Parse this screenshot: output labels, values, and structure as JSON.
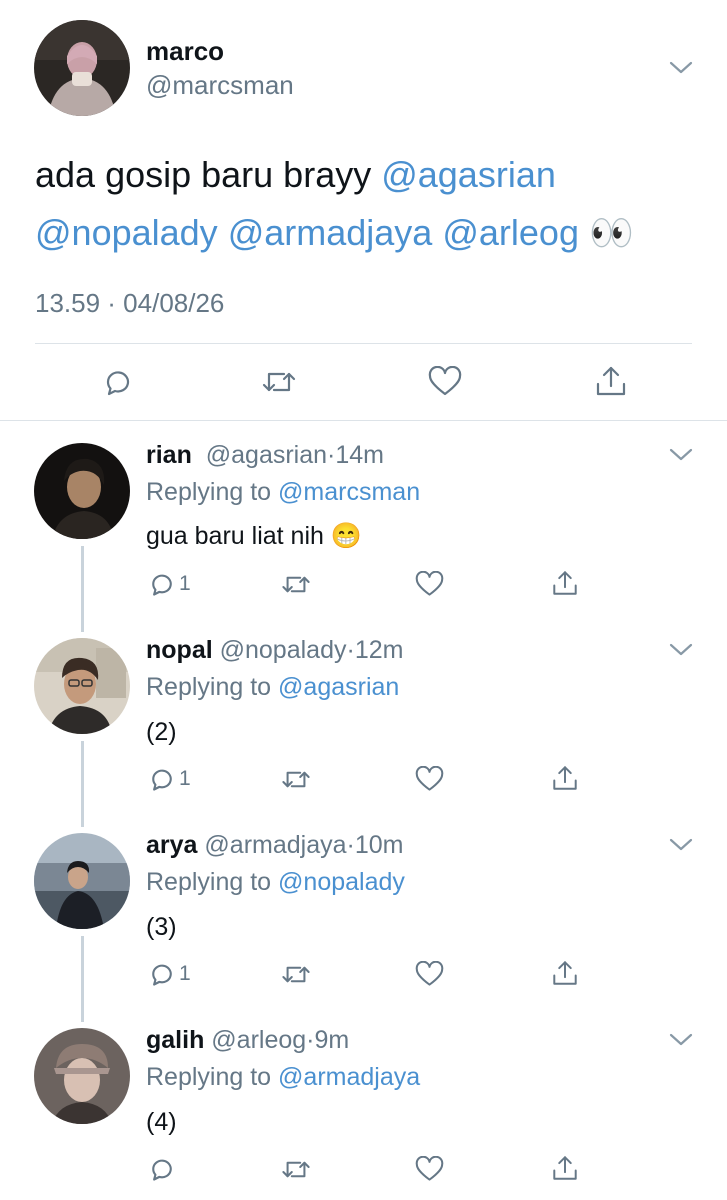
{
  "main_tweet": {
    "name": "marco",
    "handle": "@marcsman",
    "text_plain": "ada gosip baru brayy ",
    "mention1": "@agasrian",
    "mention2": "@nopalady",
    "mention3": "@armadjaya",
    "mention4": "@arleog",
    "emoji": "👀",
    "timestamp": "13.59 · 04/08/26"
  },
  "replies": [
    {
      "name": "rian",
      "handle": "@agasrian",
      "time": "14m",
      "replying_prefix": "Replying to ",
      "replying_to": "@marcsman",
      "text": "gua baru liat nih ",
      "emoji": "😁",
      "reply_count": "1"
    },
    {
      "name": "nopal",
      "handle": "@nopalady",
      "time": "12m",
      "replying_prefix": "Replying to ",
      "replying_to": "@agasrian",
      "text": "(2)",
      "reply_count": "1"
    },
    {
      "name": "arya",
      "handle": "@armadjaya",
      "time": "10m",
      "replying_prefix": "Replying to ",
      "replying_to": "@nopalady",
      "text": "(3)",
      "reply_count": "1"
    },
    {
      "name": "galih",
      "handle": "@arleog",
      "time": "9m",
      "replying_prefix": "Replying to ",
      "replying_to": "@armadjaya",
      "text": "(4)"
    }
  ],
  "separator": "·",
  "colors": {
    "link": "#4a90d0",
    "secondary": "#657786",
    "divider": "#dde3e8",
    "icon": "#657786"
  }
}
